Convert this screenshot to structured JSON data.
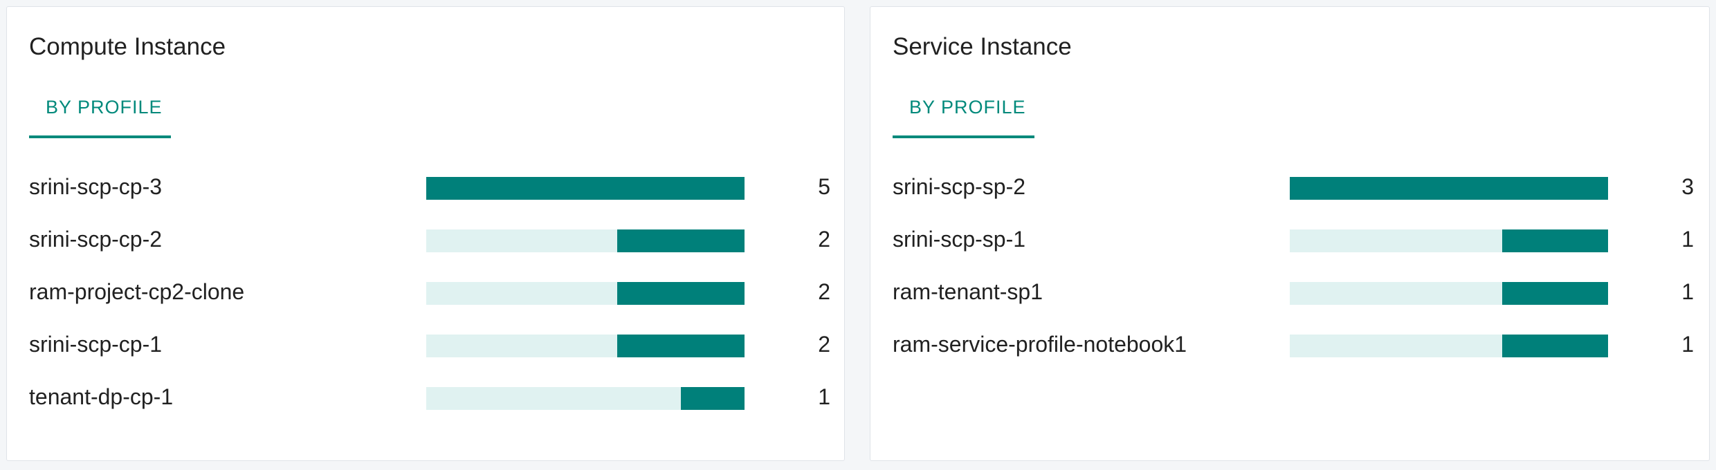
{
  "panels": [
    {
      "title": "Compute Instance",
      "tab_label": "BY PROFILE",
      "max": 5,
      "rows": [
        {
          "label": "srini-scp-cp-3",
          "value": 5,
          "display": "5"
        },
        {
          "label": "srini-scp-cp-2",
          "value": 2,
          "display": "2"
        },
        {
          "label": "ram-project-cp2-clone",
          "value": 2,
          "display": "2"
        },
        {
          "label": "srini-scp-cp-1",
          "value": 2,
          "display": "2"
        },
        {
          "label": "tenant-dp-cp-1",
          "value": 1,
          "display": "1"
        }
      ]
    },
    {
      "title": "Service Instance",
      "tab_label": "BY PROFILE",
      "max": 3,
      "rows": [
        {
          "label": "srini-scp-sp-2",
          "value": 3,
          "display": "3"
        },
        {
          "label": "srini-scp-sp-1",
          "value": 1,
          "display": "1"
        },
        {
          "label": "ram-tenant-sp1",
          "value": 1,
          "display": "1"
        },
        {
          "label": "ram-service-profile-notebook1",
          "value": 1,
          "display": "1"
        }
      ]
    }
  ],
  "colors": {
    "accent": "#00897b",
    "bar_fill": "#00807a",
    "bar_track": "#e0f2f1"
  }
}
